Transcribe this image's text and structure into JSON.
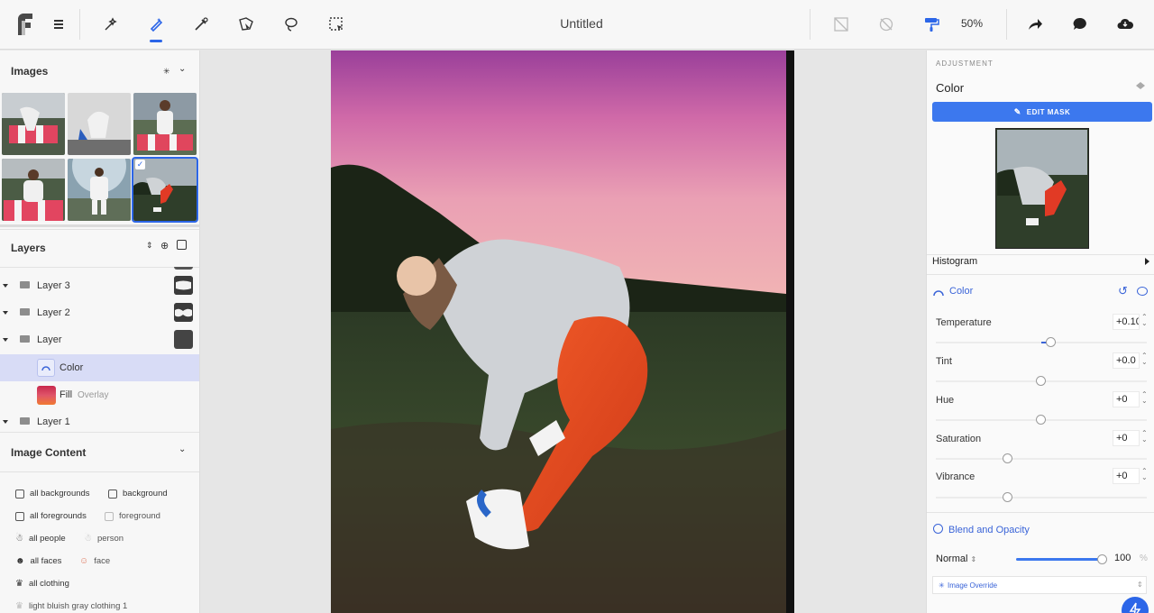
{
  "toolbar": {
    "title": "Untitled",
    "zoom": "50%"
  },
  "images_panel": {
    "title": "Images"
  },
  "layers_panel": {
    "title": "Layers",
    "rows": [
      {
        "label": "Layer 3"
      },
      {
        "label": "Layer 2"
      },
      {
        "label": "Layer"
      },
      {
        "label": "Color"
      },
      {
        "label": "Fill",
        "sublabel": "Overlay"
      },
      {
        "label": "Layer 1"
      }
    ]
  },
  "image_content": {
    "title": "Image Content",
    "tags": [
      {
        "label": "all backgrounds"
      },
      {
        "label": "background"
      },
      {
        "label": "all foregrounds"
      },
      {
        "label": "foreground"
      },
      {
        "label": "all people"
      },
      {
        "label": "person"
      },
      {
        "label": "all faces"
      },
      {
        "label": "face"
      },
      {
        "label": "all clothing"
      },
      {
        "label": "light bluish gray clothing 1"
      }
    ]
  },
  "adjustment": {
    "section": "ADJUSTMENT",
    "title": "Color",
    "edit_mask": "EDIT MASK",
    "histogram": "Histogram",
    "color_group": "Color",
    "sliders": [
      {
        "label": "Temperature",
        "value": "+0.10",
        "level": 0.52
      },
      {
        "label": "Tint",
        "value": "+0.0",
        "level": 0.5
      },
      {
        "label": "Hue",
        "value": "+0",
        "level": 0.5
      },
      {
        "label": "Saturation",
        "value": "+0",
        "level": 0.34
      },
      {
        "label": "Vibrance",
        "value": "+0",
        "level": 0.34
      }
    ],
    "blend_title": "Blend and Opacity",
    "blend_mode": "Normal",
    "opacity": "100",
    "opacity_unit": "%",
    "opacity_level": 1.0,
    "override": "Image Override"
  },
  "colors": {
    "accent": "#2c66e8",
    "button": "#3c78ee",
    "selection": "#d8dcf6"
  }
}
